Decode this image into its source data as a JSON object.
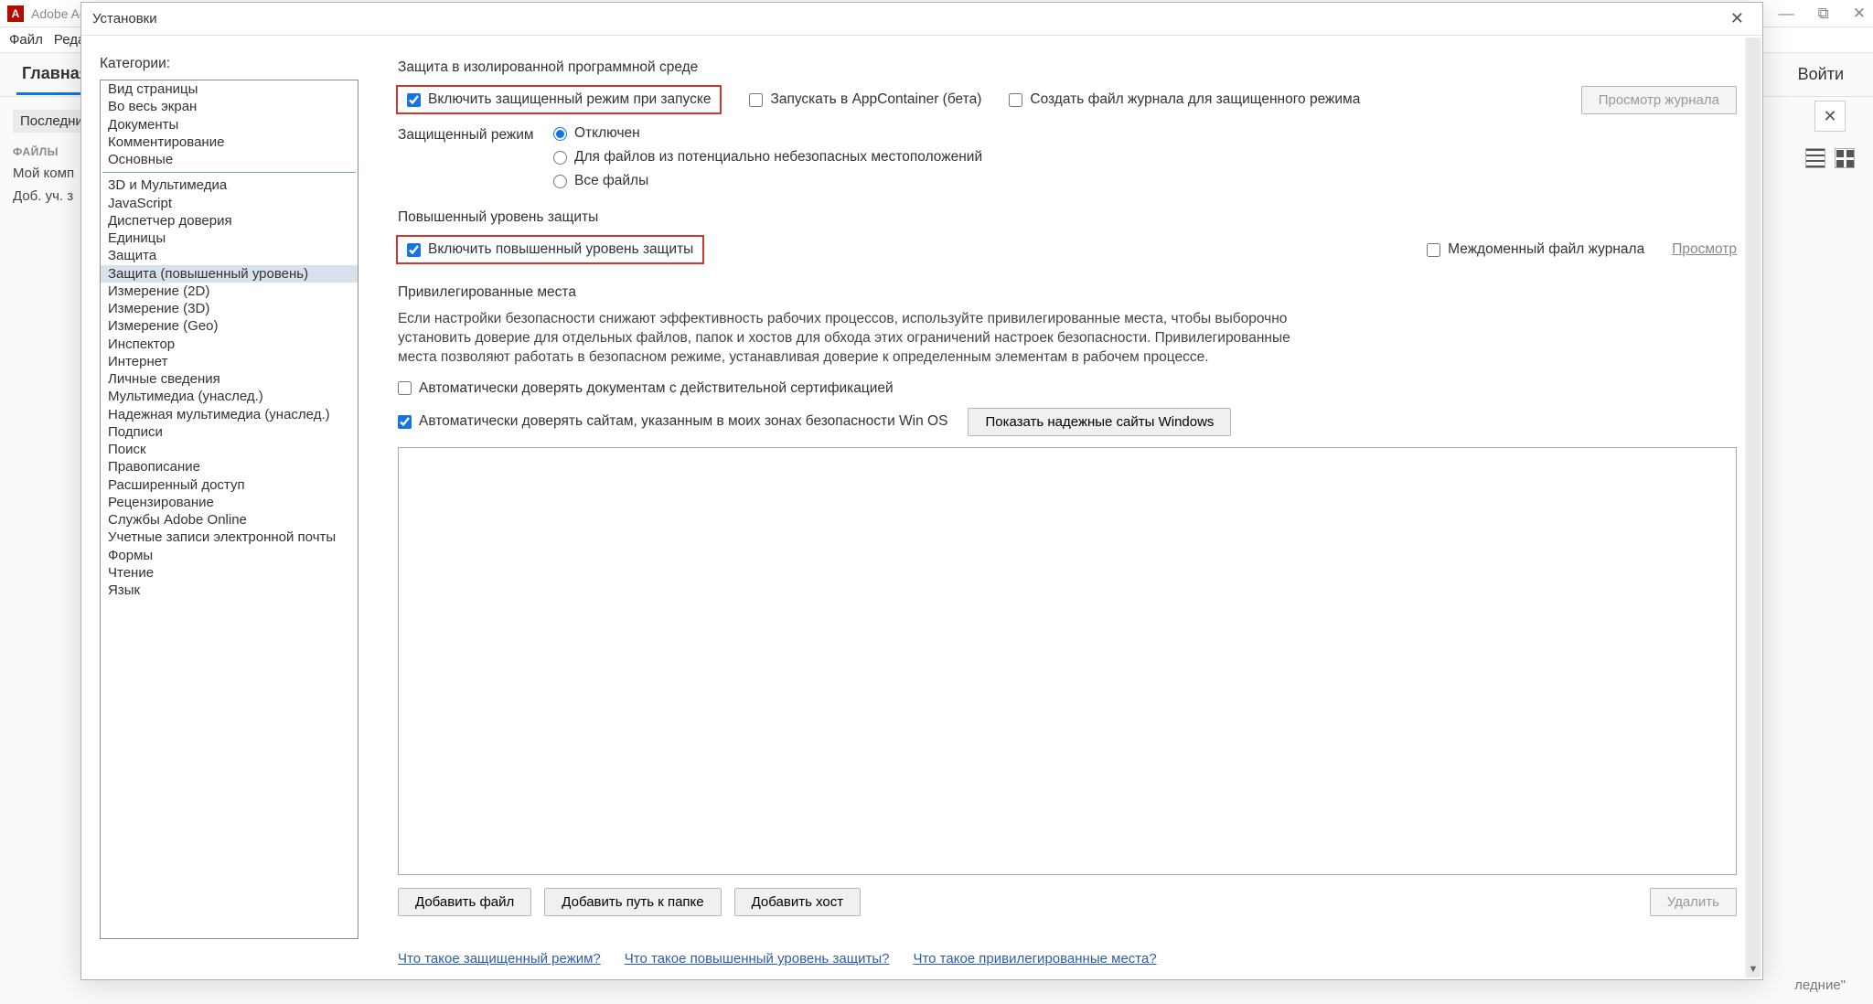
{
  "bg": {
    "logo_letter": "A",
    "app_title": "Adobe Acro",
    "menu": [
      "Файл",
      "Редакти"
    ],
    "tab_main": "Главная",
    "sub_recent": "Последни",
    "sec_files": "ФАЙЛЫ",
    "item_mycomp": "Мой комп",
    "item_addacct": "Доб. уч. з",
    "signin": "Войти",
    "bottom_text": "ледние\""
  },
  "dialog": {
    "title": "Установки",
    "categories_label": "Категории:",
    "categories_top": [
      "Вид страницы",
      "Во весь экран",
      "Документы",
      "Комментирование",
      "Основные"
    ],
    "categories": [
      "3D и Мультимедиа",
      "JavaScript",
      "Диспетчер доверия",
      "Единицы",
      "Защита",
      "Защита (повышенный уровень)",
      "Измерение (2D)",
      "Измерение (3D)",
      "Измерение (Geo)",
      "Инспектор",
      "Интернет",
      "Личные сведения",
      "Мультимедиа (унаслед.)",
      "Надежная мультимедиа (унаслед.)",
      "Подписи",
      "Поиск",
      "Правописание",
      "Расширенный доступ",
      "Рецензирование",
      "Службы Adobe Online",
      "Учетные записи электронной почты",
      "Формы",
      "Чтение",
      "Язык"
    ],
    "selected_category": "Защита (повышенный уровень)",
    "sec_sandbox": {
      "title": "Защита в изолированной программной среде",
      "enable_protected": "Включить защищенный режим при запуске",
      "appcontainer": "Запускать в AppContainer (бета)",
      "create_log": "Создать файл журнала для защищенного режима",
      "view_log_btn": "Просмотр журнала",
      "mode_label": "Защищенный режим",
      "opt_off": "Отключен",
      "opt_unsafe": "Для файлов из потенциально небезопасных местоположений",
      "opt_all": "Все файлы"
    },
    "sec_enhanced": {
      "title": "Повышенный уровень защиты",
      "enable_enhanced": "Включить повышенный уровень защиты",
      "crossdomain": "Междоменный файл журнала",
      "view_link": "Просмотр"
    },
    "sec_priv": {
      "title": "Привилегированные места",
      "desc": "Если настройки безопасности снижают эффективность рабочих процессов, используйте привилегированные места, чтобы выборочно установить доверие для отдельных файлов, папок и хостов для обхода этих ограничений настроек безопасности. Привилегированные места позволяют работать в безопасном режиме, устанавливая доверие к определенным элементам в рабочем процессе.",
      "trust_cert": "Автоматически доверять документам с действительной сертификацией",
      "trust_winos": "Автоматически доверять сайтам, указанным в моих зонах безопасности Win OS",
      "show_win_btn": "Показать надежные сайты Windows",
      "add_file": "Добавить файл",
      "add_folder": "Добавить путь к папке",
      "add_host": "Добавить хост",
      "delete_btn": "Удалить"
    },
    "footer": {
      "l1": "Что такое защищенный режим?",
      "l2": "Что такое повышенный уровень защиты?",
      "l3": "Что такое привилегированные места?"
    }
  }
}
